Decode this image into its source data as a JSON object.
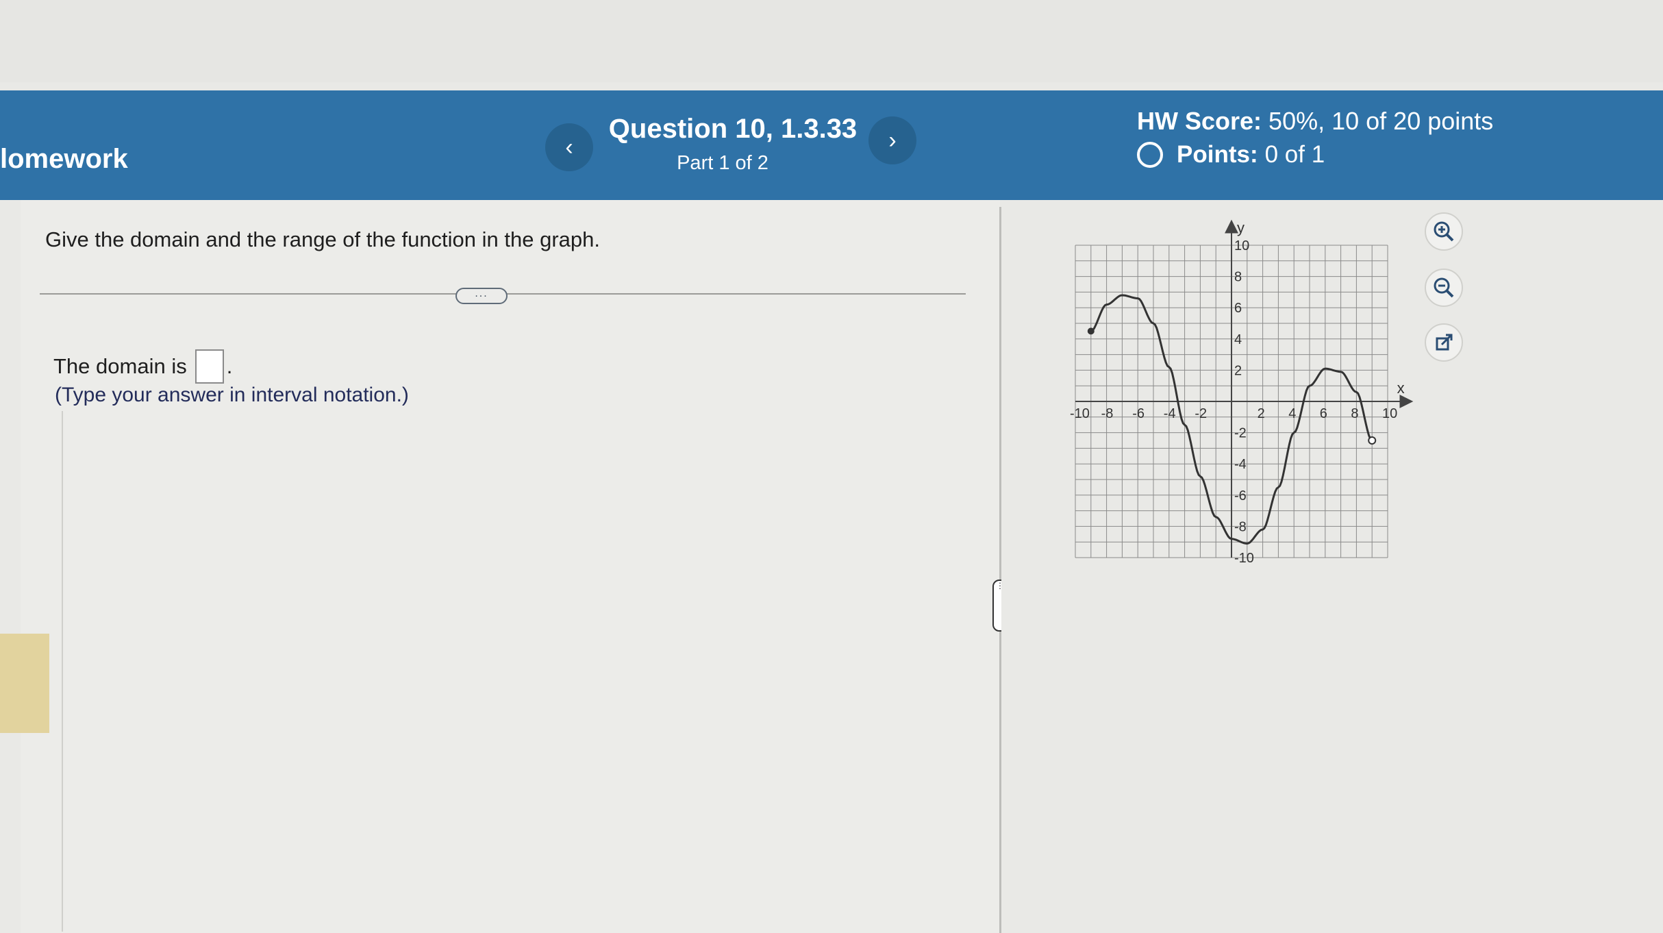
{
  "header": {
    "section_label": "lomework",
    "prev_icon": "chevron-left",
    "next_icon": "chevron-right",
    "question_title": "Question 10, 1.3.33",
    "question_part": "Part 1 of 2",
    "hw_score_label": "HW Score:",
    "hw_score_value": "50%, 10 of 20 points",
    "points_label": "Points:",
    "points_value": "0 of 1"
  },
  "question": {
    "prompt": "Give the domain and the range of the function in the graph.",
    "more_label": "...",
    "domain_label": "The domain is",
    "domain_value": "",
    "period": ".",
    "instruction": "(Type your answer in interval notation.)"
  },
  "graph": {
    "x_label": "x",
    "y_label": "y",
    "x_ticks": [
      "-10",
      "-8",
      "-6",
      "-4",
      "-2",
      "2",
      "4",
      "6",
      "8",
      "10"
    ],
    "y_ticks": [
      "10",
      "8",
      "6",
      "4",
      "2",
      "-2",
      "-4",
      "-6",
      "-8",
      "-10"
    ],
    "start_point": [
      -9,
      4.5
    ],
    "end_point": [
      9,
      -2.5
    ],
    "start_closed": true,
    "end_open": true
  },
  "tools": {
    "zoom_in": "zoom-in-icon",
    "zoom_out": "zoom-out-icon",
    "popout": "popout-icon"
  },
  "colors": {
    "header_bg": "#2f72a7",
    "page_bg": "#e9e9e6",
    "instruction_text": "#232c5a"
  }
}
